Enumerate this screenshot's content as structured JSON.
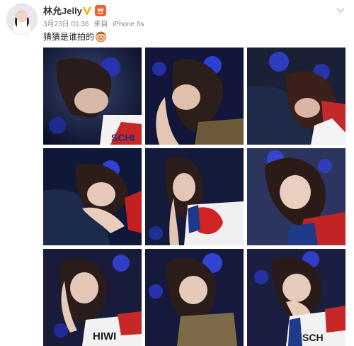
{
  "post": {
    "username": "林允Jelly",
    "timestamp": "3月23日 01:36",
    "source_prefix": "来自",
    "source_device": "iPhone 6s",
    "text": "猜猜是谁拍的",
    "icons": {
      "verified": "verified-v-icon",
      "member": "member-badge-icon",
      "emoji": "embarrassed-face-emoji",
      "dropdown": "chevron-down-icon"
    },
    "colors": {
      "verified": "#f7b500",
      "member": "#f25f2a",
      "meta_text": "#8a8a8a",
      "dropdown": "#c9c9c9"
    }
  },
  "photos": [
    {
      "id": 1,
      "desc": "selfie-photo-1"
    },
    {
      "id": 2,
      "desc": "selfie-photo-2"
    },
    {
      "id": 3,
      "desc": "selfie-photo-3"
    },
    {
      "id": 4,
      "desc": "selfie-photo-4"
    },
    {
      "id": 5,
      "desc": "selfie-photo-5"
    },
    {
      "id": 6,
      "desc": "selfie-photo-6"
    },
    {
      "id": 7,
      "desc": "selfie-photo-7"
    },
    {
      "id": 8,
      "desc": "selfie-photo-8"
    },
    {
      "id": 9,
      "desc": "selfie-photo-9"
    }
  ]
}
